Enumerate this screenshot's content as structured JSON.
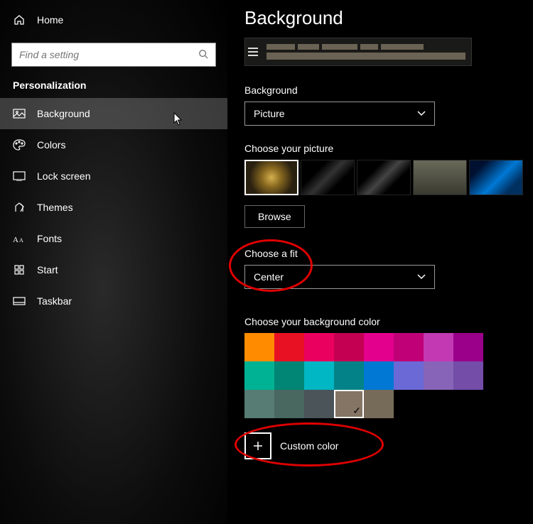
{
  "sidebar": {
    "home": "Home",
    "search_placeholder": "Find a setting",
    "section": "Personalization",
    "items": [
      {
        "label": "Background"
      },
      {
        "label": "Colors"
      },
      {
        "label": "Lock screen"
      },
      {
        "label": "Themes"
      },
      {
        "label": "Fonts"
      },
      {
        "label": "Start"
      },
      {
        "label": "Taskbar"
      }
    ]
  },
  "main": {
    "title": "Background",
    "bg_label": "Background",
    "bg_value": "Picture",
    "choose_picture": "Choose your picture",
    "browse": "Browse",
    "fit_label": "Choose a fit",
    "fit_value": "Center",
    "bgcolor_label": "Choose your background color",
    "custom_color": "Custom color",
    "colors": [
      "#ff8c00",
      "#e81123",
      "#ea005e",
      "#c30052",
      "#e3008c",
      "#bf0077",
      "#c239b3",
      "#9a0089",
      "#00b294",
      "#018574",
      "#00b7c3",
      "#038387",
      "#0078d4",
      "#6b69d6",
      "#8764b8",
      "#744da9",
      "#567c73",
      "#486860",
      "#4a5459",
      "#847564",
      "#766b59"
    ],
    "selected_color_index": 19
  }
}
